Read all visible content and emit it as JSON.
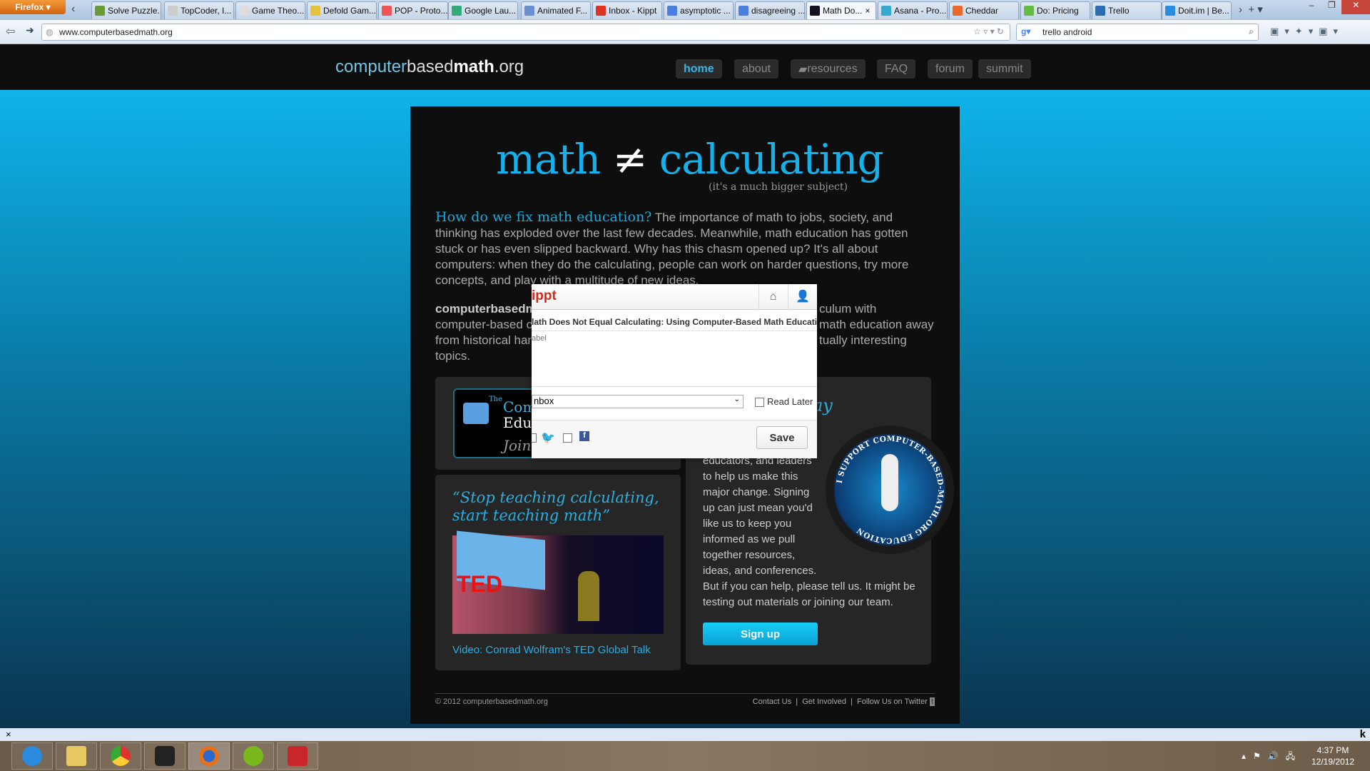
{
  "browser": {
    "menu": "Firefox",
    "tabs": [
      "Solve Puzzle...",
      "TopCoder, I...",
      "Game Theo...",
      "Defold Gam...",
      "POP - Proto...",
      "Google Lau...",
      "Animated F...",
      "Inbox - Kippt",
      "asymptotic ...",
      "disagreeing ...",
      "Math Do...",
      "Asana - Pro...",
      "Cheddar",
      "Do: Pricing",
      "Trello",
      "Doit.im | Be..."
    ],
    "tab_colors": [
      "#6a9a3a",
      "#ccc",
      "#ddd",
      "#e3c23c",
      "#e55",
      "#3a7",
      "#6a8fd0",
      "#d32",
      "#4a7fe0",
      "#4a7fe0",
      "#112",
      "#3ac",
      "#e86a2a",
      "#6b4",
      "#2a6db5",
      "#2a8de0"
    ],
    "active_tab": 10,
    "url": "www.computerbasedmath.org",
    "search": "trello android"
  },
  "site": {
    "logo": {
      "a": "computer",
      "b": "based",
      "c": "math",
      ".org": ".org"
    },
    "nav": [
      "home",
      "about",
      "resources",
      "FAQ",
      "forum",
      "summit"
    ],
    "headline": {
      "left": "math",
      "sign": "≠",
      "right": "calculating",
      "sub": "(it's a much bigger subject)"
    },
    "intro_q": "How do we fix math education?",
    "intro": " The importance of math to jobs, society, and thinking has exploded over the last few decades. Meanwhile, math education has gotten stuck or has even slipped backward. Why has this chasm opened up? It's all about computers: when they do the calculating, people can work on harder questions, try more concepts, and play with a multitude of new ideas.",
    "p2_bold": "computerbasedm",
    "p2_l2a": "computer-based co",
    "p2_l3a": "from historical hanc",
    "p2_l4": "topics.",
    "p2_r1": "culum with",
    "p2_r2": "math education away",
    "p2_r3": "tually interesting",
    "community": {
      "the": "The",
      "l1": "Com",
      "l2": "Edu",
      "join": "Join"
    },
    "quote": "“Stop teaching calculating, start teaching math”",
    "ted": "TED",
    "video_link": "Video: Conrad Wolfram's TED Global Talk",
    "right_title_frag": "ay",
    "right_text": [
      "educators, and leaders",
      "to help us make this",
      "major change. Signing",
      "up can just mean you'd",
      "like us to keep you",
      "informed as we pull",
      "together resources,",
      "ideas, and conferences.",
      "But if you can help, please tell us. It might be",
      "testing out materials or joining our team."
    ],
    "badge": "I SUPPORT COMPUTER-BASED-MATH.ORG EDUCATION",
    "signup": "Sign up",
    "footer": {
      "copy": "© 2012 computerbasedmath.org",
      "links": [
        "Contact Us",
        "Get Involved",
        "Follow Us on Twitter"
      ]
    }
  },
  "kippt": {
    "brand": "ippt",
    "title": "lath Does Not Equal Calculating: Using Computer-Based Math Educati",
    "label_placeholder": "abel",
    "list": "nbox",
    "read_later": "Read Later",
    "save": "Save"
  },
  "taskbar": {
    "time": "4:37 PM",
    "date": "12/19/2012",
    "apps": [
      "internet-explorer",
      "file-explorer",
      "chrome",
      "steam",
      "firefox",
      "spotify",
      "wunderlist"
    ]
  }
}
